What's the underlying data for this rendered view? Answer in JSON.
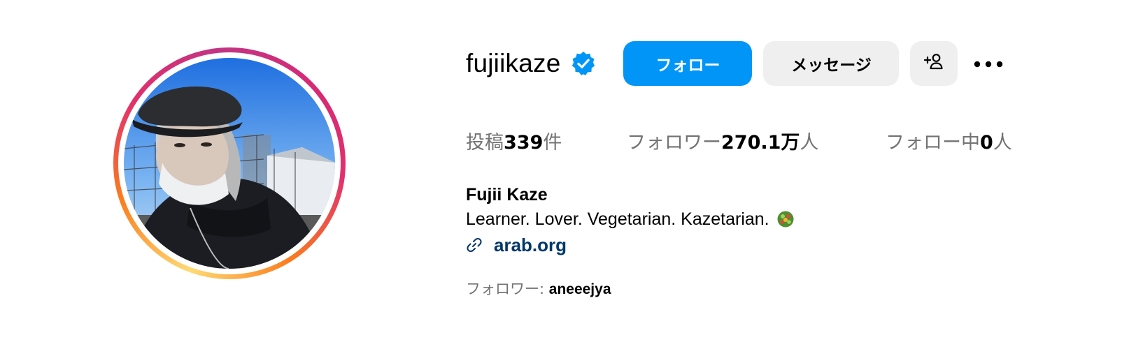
{
  "profile": {
    "username": "fujiikaze",
    "verified": true,
    "full_name": "Fujii Kaze",
    "bio": "Learner. Lover. Vegetarian. Kazetarian.",
    "bio_emoji": "vegetable-bowl-emoji",
    "link": "arab.org"
  },
  "actions": {
    "follow_label": "フォロー",
    "message_label": "メッセージ",
    "add_user_icon": "add-user-icon",
    "more_icon": "more-options-icon"
  },
  "stats": {
    "posts_label": "投稿",
    "posts_count": "339",
    "posts_unit": "件",
    "followers_label": "フォロワー",
    "followers_count": "270.1万",
    "followers_unit": "人",
    "following_label": "フォロー中",
    "following_count": "0",
    "following_unit": "人"
  },
  "followed_by": {
    "label": "フォロワー: ",
    "name": "aneeejya"
  },
  "colors": {
    "follow_button": "#0095f6",
    "secondary_button": "#efefef",
    "verified_badge": "#0095f6",
    "link_text": "#00376b",
    "muted_text": "#737373"
  }
}
